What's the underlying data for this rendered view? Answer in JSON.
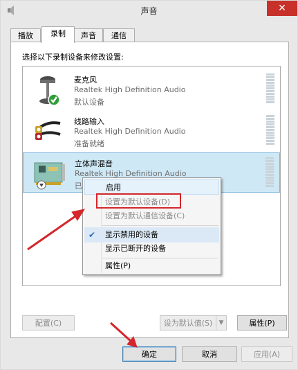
{
  "window": {
    "title": "声音"
  },
  "tabs": [
    {
      "label": "播放"
    },
    {
      "label": "录制"
    },
    {
      "label": "声音"
    },
    {
      "label": "通信"
    }
  ],
  "instruction": "选择以下录制设备来修改设置:",
  "devices": [
    {
      "name": "麦克风",
      "driver": "Realtek High Definition Audio",
      "status": "默认设备",
      "icon": "microphone-icon"
    },
    {
      "name": "线路输入",
      "driver": "Realtek High Definition Audio",
      "status": "准备就绪",
      "icon": "line-in-icon"
    },
    {
      "name": "立体声混音",
      "driver": "Realtek High Definition Audio",
      "status": "已停用",
      "icon": "sound-card-icon"
    }
  ],
  "context_menu": [
    {
      "label": "启用"
    },
    {
      "label": "设置为默认设备(D)"
    },
    {
      "label": "设置为默认通信设备(C)"
    },
    {
      "label": "显示禁用的设备"
    },
    {
      "label": "显示已断开的设备"
    },
    {
      "label": "属性(P)"
    }
  ],
  "panel_buttons": {
    "configure": "配置(C)",
    "set_default": "设为默认值(S)",
    "properties": "属性(P)"
  },
  "dialog_buttons": {
    "ok": "确定",
    "cancel": "取消",
    "apply": "应用(A)"
  },
  "colors": {
    "accent": "#d4262b",
    "selection": "#cfe8f6",
    "close": "#c7312a"
  }
}
